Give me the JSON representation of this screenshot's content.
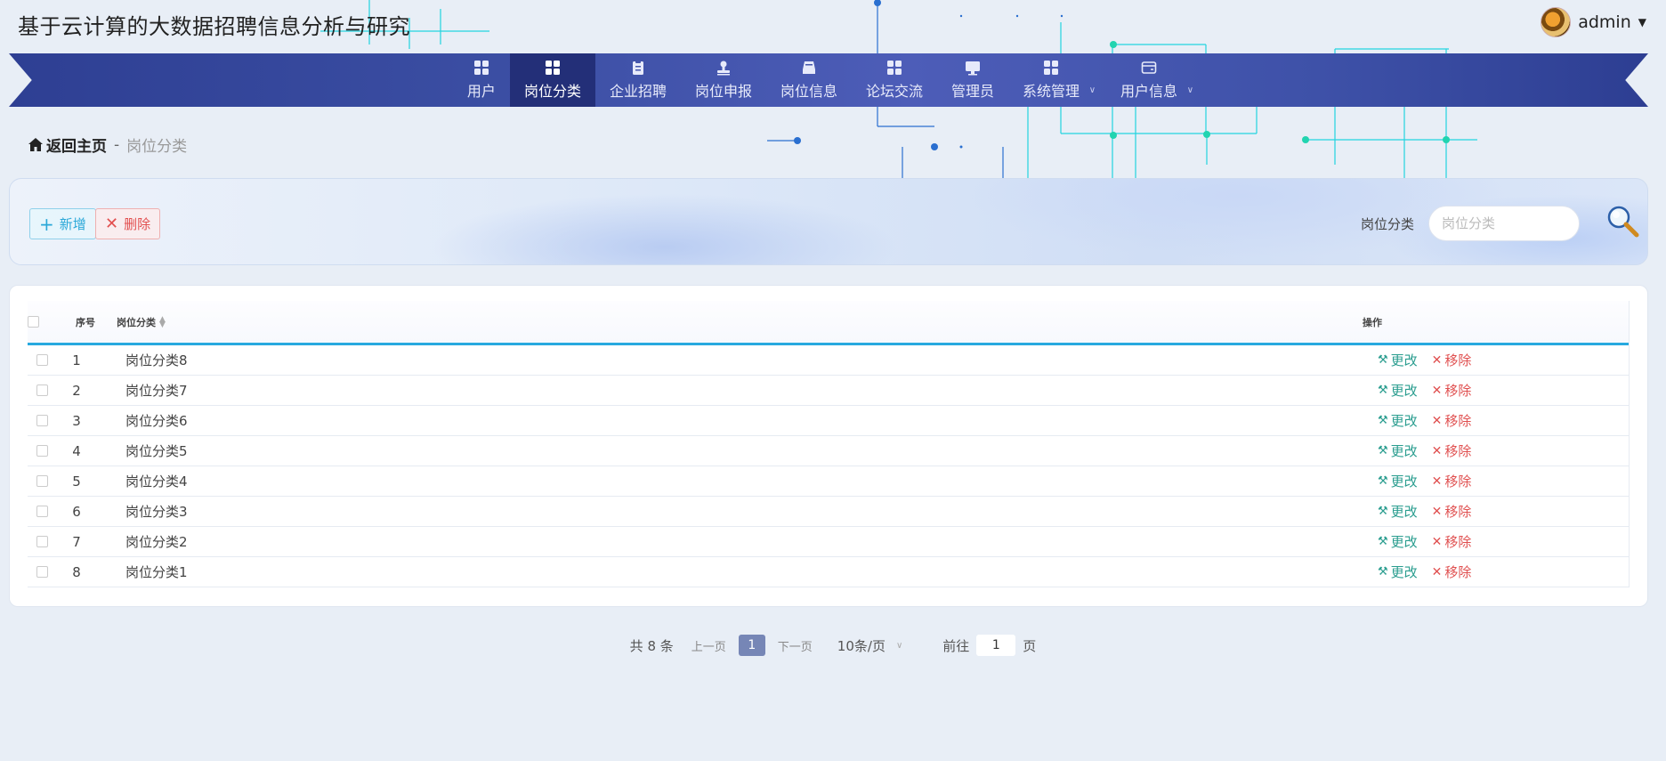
{
  "site": {
    "title": "基于云计算的大数据招聘信息分析与研究",
    "user_name": "admin"
  },
  "nav": {
    "items": [
      {
        "label": "用户",
        "icon": "grid-icon",
        "active": false
      },
      {
        "label": "岗位分类",
        "icon": "grid-icon",
        "active": true
      },
      {
        "label": "企业招聘",
        "icon": "clipboard-icon",
        "active": false
      },
      {
        "label": "岗位申报",
        "icon": "stamp-icon",
        "active": false
      },
      {
        "label": "岗位信息",
        "icon": "inbox-icon",
        "active": false
      },
      {
        "label": "论坛交流",
        "icon": "grid-icon",
        "active": false
      },
      {
        "label": "管理员",
        "icon": "monitor-icon",
        "active": false
      },
      {
        "label": "系统管理",
        "icon": "grid-icon",
        "active": false
      },
      {
        "label": "用户信息",
        "icon": "wallet-icon",
        "active": false
      }
    ]
  },
  "breadcrumb": {
    "home": "返回主页",
    "separator": "-",
    "current": "岗位分类"
  },
  "toolbar": {
    "add_label": "新增",
    "delete_label": "删除",
    "search_label": "岗位分类",
    "search_placeholder": "岗位分类"
  },
  "table": {
    "columns": {
      "index": "序号",
      "name": "岗位分类",
      "ops": "操作"
    },
    "edit_label": "更改",
    "remove_label": "移除",
    "rows": [
      {
        "index": "1",
        "name": "岗位分类8"
      },
      {
        "index": "2",
        "name": "岗位分类7"
      },
      {
        "index": "3",
        "name": "岗位分类6"
      },
      {
        "index": "4",
        "name": "岗位分类5"
      },
      {
        "index": "5",
        "name": "岗位分类4"
      },
      {
        "index": "6",
        "name": "岗位分类3"
      },
      {
        "index": "7",
        "name": "岗位分类2"
      },
      {
        "index": "8",
        "name": "岗位分类1"
      }
    ]
  },
  "pager": {
    "total": "共 8 条",
    "prev": "上一页",
    "current_page": "1",
    "next": "下一页",
    "page_size": "10条/页",
    "goto_prefix": "前往",
    "goto_value": "1",
    "goto_suffix": "页"
  },
  "colors": {
    "nav_bg": "#3b4ea3",
    "nav_active": "#232f78",
    "accent": "#27a9df",
    "edit": "#2a9d8f",
    "delete": "#e05050"
  }
}
